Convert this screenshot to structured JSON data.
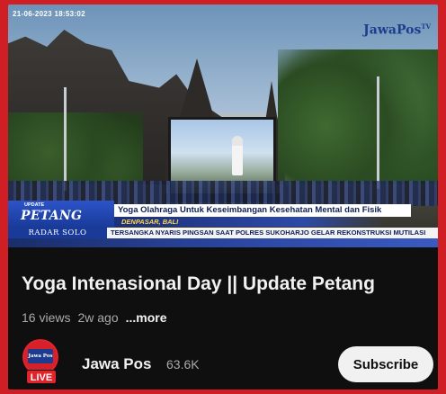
{
  "video": {
    "timestamp": "21-06-2023  18:53:02",
    "logo_text": "JawaPos",
    "logo_suffix": "TV",
    "segment_small": "UPDATE",
    "segment_name": "PETANG",
    "headline": "Yoga Olahraga Untuk Keseimbangan Kesehatan Mental dan Fisik",
    "location": "DENPASAR, BALI",
    "station": "RADAR SOLO",
    "ticker": "TERSANGKA NYARIS PINGSAN SAAT POLRES SUKOHARJO GELAR REKONSTRUKSI MUTILASI"
  },
  "info": {
    "title": "Yoga Intenasional Day || Update Petang",
    "views": "16 views",
    "age": "2w ago",
    "more_label": "...more"
  },
  "channel": {
    "avatar_text": "Jawa Pos",
    "live_label": "LIVE",
    "name": "Jawa Pos",
    "subscribers": "63.6K",
    "subscribe_label": "Subscribe"
  },
  "colors": {
    "border": "#cf1f24",
    "background": "#0f0f0f",
    "subscribe_bg": "#f1f1f1",
    "live": "#e1232c"
  }
}
